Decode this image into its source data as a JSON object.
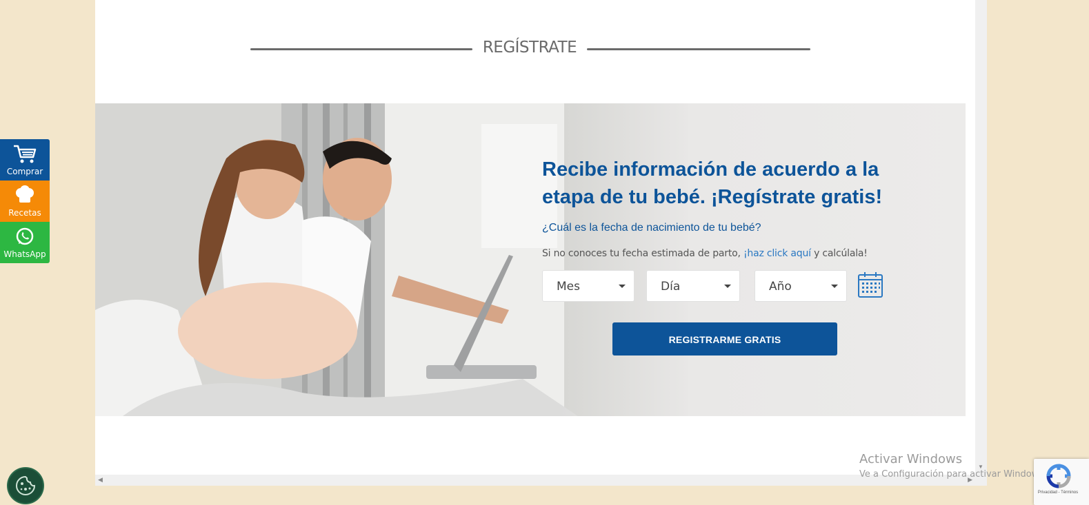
{
  "section": {
    "title": "REGÍSTRATE"
  },
  "hero": {
    "headline": "Recibe información de acuerdo a la etapa de tu bebé. ¡Regístrate gratis!",
    "question": "¿Cuál es la fecha de nacimiento de tu bebé?",
    "hint_prefix": "Si no conoces tu fecha estimada de parto, ",
    "hint_link": "¡haz click aquí",
    "hint_suffix": " y calcúlala!",
    "selects": {
      "month": "Mes",
      "day": "Día",
      "year": "Año"
    },
    "calendar_icon": "calendar-icon",
    "submit_label": "REGISTRARME GRATIS"
  },
  "side_buttons": [
    {
      "label": "Comprar",
      "icon": "cart-icon",
      "color": "#0d5499"
    },
    {
      "label": "Recetas",
      "icon": "chef-hat-icon",
      "color": "#f58a07"
    },
    {
      "label": "WhatsApp",
      "icon": "whatsapp-icon",
      "color": "#2db742"
    }
  ],
  "windows_watermark": {
    "title": "Activar Windows",
    "subtitle": "Ve a Configuración para activar Windows."
  },
  "recaptcha": {
    "links": "Privacidad - Términos"
  },
  "colors": {
    "brand_blue": "#0d5499",
    "link_blue": "#2a78c2",
    "page_bg": "#f3e6cb"
  }
}
